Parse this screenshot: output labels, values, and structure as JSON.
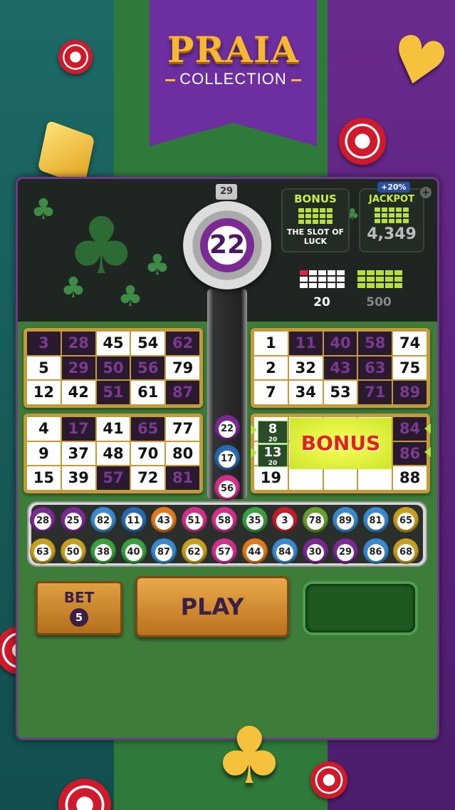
{
  "logo": {
    "title": "PRAIA",
    "subtitle": "COLLECTION"
  },
  "counter": "29",
  "current_ball": "22",
  "bonus": {
    "label": "BONUS",
    "subtitle": "THE SLOT OF LUCK"
  },
  "jackpot": {
    "label": "JACKPOT",
    "badge": "+20%",
    "value": "4,349",
    "plus": "+"
  },
  "patterns": [
    {
      "value": "20"
    },
    {
      "value": "500"
    }
  ],
  "cards": [
    {
      "cells": [
        [
          "3",
          "28",
          "45",
          "54",
          "62"
        ],
        [
          "5",
          "29",
          "50",
          "56",
          "79"
        ],
        [
          "12",
          "42",
          "51",
          "61",
          "87"
        ]
      ],
      "marked": [
        [
          1,
          1,
          0,
          0,
          1
        ],
        [
          0,
          1,
          1,
          1,
          0
        ],
        [
          0,
          0,
          1,
          0,
          1
        ]
      ]
    },
    {
      "cells": [
        [
          "1",
          "11",
          "40",
          "58",
          "74"
        ],
        [
          "2",
          "32",
          "43",
          "63",
          "75"
        ],
        [
          "7",
          "34",
          "53",
          "71",
          "89"
        ]
      ],
      "marked": [
        [
          0,
          1,
          1,
          1,
          0
        ],
        [
          0,
          0,
          1,
          1,
          0
        ],
        [
          0,
          0,
          0,
          1,
          1
        ]
      ]
    },
    {
      "cells": [
        [
          "4",
          "17",
          "41",
          "65",
          "77"
        ],
        [
          "9",
          "37",
          "48",
          "70",
          "80"
        ],
        [
          "15",
          "39",
          "57",
          "72",
          "81"
        ]
      ],
      "marked": [
        [
          0,
          1,
          0,
          1,
          0
        ],
        [
          0,
          0,
          0,
          0,
          0
        ],
        [
          0,
          0,
          1,
          0,
          1
        ]
      ]
    },
    {
      "cells": [
        [
          "",
          "",
          "",
          "",
          "84"
        ],
        [
          "",
          "",
          "",
          "",
          "86"
        ],
        [
          "19",
          "",
          "",
          "",
          "88"
        ]
      ],
      "marked": [
        [
          0,
          0,
          0,
          0,
          1
        ],
        [
          0,
          0,
          0,
          0,
          1
        ],
        [
          0,
          0,
          0,
          0,
          0
        ]
      ]
    }
  ],
  "card4_mini": [
    {
      "num": "8",
      "sub": "20"
    },
    {
      "num": "13",
      "sub": "20"
    }
  ],
  "bonus_overlay": "BONUS",
  "tube_balls": [
    {
      "num": "22",
      "color": "#7a2a92"
    },
    {
      "num": "17",
      "color": "#2a6ab0"
    },
    {
      "num": "56",
      "color": "#d0308a"
    }
  ],
  "tray_row1": [
    {
      "num": "28",
      "color": "#7a2a92"
    },
    {
      "num": "25",
      "color": "#7a2a92"
    },
    {
      "num": "82",
      "color": "#3a8ad0"
    },
    {
      "num": "11",
      "color": "#2a6ab0"
    },
    {
      "num": "43",
      "color": "#e07a1c"
    },
    {
      "num": "51",
      "color": "#d0308a"
    },
    {
      "num": "58",
      "color": "#d0308a"
    },
    {
      "num": "35",
      "color": "#3aa040"
    },
    {
      "num": "3",
      "color": "#c0202a"
    },
    {
      "num": "78",
      "color": "#6aa030"
    },
    {
      "num": "89",
      "color": "#3a8ad0"
    },
    {
      "num": "81",
      "color": "#3a8ad0"
    },
    {
      "num": "65",
      "color": "#c8a020"
    }
  ],
  "tray_row2": [
    {
      "num": "63",
      "color": "#c8a020"
    },
    {
      "num": "50",
      "color": "#c8a020"
    },
    {
      "num": "38",
      "color": "#3aa040"
    },
    {
      "num": "40",
      "color": "#3aa040"
    },
    {
      "num": "87",
      "color": "#3a8ad0"
    },
    {
      "num": "62",
      "color": "#c8a020"
    },
    {
      "num": "57",
      "color": "#d0308a"
    },
    {
      "num": "44",
      "color": "#e07a1c"
    },
    {
      "num": "84",
      "color": "#3a8ad0"
    },
    {
      "num": "30",
      "color": "#7a2a92"
    },
    {
      "num": "29",
      "color": "#7a2a92"
    },
    {
      "num": "86",
      "color": "#3a8ad0"
    },
    {
      "num": "68",
      "color": "#c8a020"
    }
  ],
  "buttons": {
    "bet_label": "BET",
    "bet_value": "5",
    "play_label": "PLAY"
  }
}
